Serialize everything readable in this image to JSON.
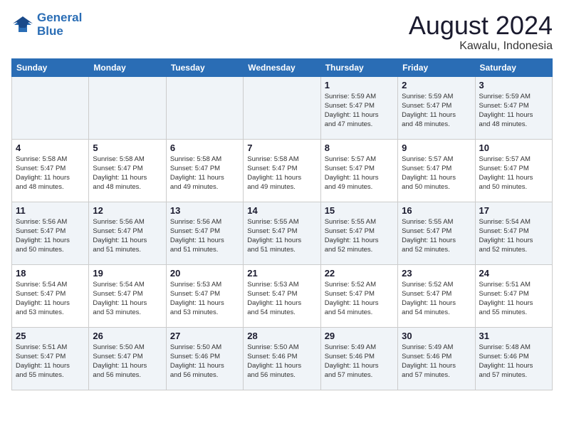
{
  "header": {
    "logo_line1": "General",
    "logo_line2": "Blue",
    "month_year": "August 2024",
    "location": "Kawalu, Indonesia"
  },
  "days_of_week": [
    "Sunday",
    "Monday",
    "Tuesday",
    "Wednesday",
    "Thursday",
    "Friday",
    "Saturday"
  ],
  "weeks": [
    [
      {
        "day": "",
        "info": ""
      },
      {
        "day": "",
        "info": ""
      },
      {
        "day": "",
        "info": ""
      },
      {
        "day": "",
        "info": ""
      },
      {
        "day": "1",
        "info": "Sunrise: 5:59 AM\nSunset: 5:47 PM\nDaylight: 11 hours\nand 47 minutes."
      },
      {
        "day": "2",
        "info": "Sunrise: 5:59 AM\nSunset: 5:47 PM\nDaylight: 11 hours\nand 48 minutes."
      },
      {
        "day": "3",
        "info": "Sunrise: 5:59 AM\nSunset: 5:47 PM\nDaylight: 11 hours\nand 48 minutes."
      }
    ],
    [
      {
        "day": "4",
        "info": "Sunrise: 5:58 AM\nSunset: 5:47 PM\nDaylight: 11 hours\nand 48 minutes."
      },
      {
        "day": "5",
        "info": "Sunrise: 5:58 AM\nSunset: 5:47 PM\nDaylight: 11 hours\nand 48 minutes."
      },
      {
        "day": "6",
        "info": "Sunrise: 5:58 AM\nSunset: 5:47 PM\nDaylight: 11 hours\nand 49 minutes."
      },
      {
        "day": "7",
        "info": "Sunrise: 5:58 AM\nSunset: 5:47 PM\nDaylight: 11 hours\nand 49 minutes."
      },
      {
        "day": "8",
        "info": "Sunrise: 5:57 AM\nSunset: 5:47 PM\nDaylight: 11 hours\nand 49 minutes."
      },
      {
        "day": "9",
        "info": "Sunrise: 5:57 AM\nSunset: 5:47 PM\nDaylight: 11 hours\nand 50 minutes."
      },
      {
        "day": "10",
        "info": "Sunrise: 5:57 AM\nSunset: 5:47 PM\nDaylight: 11 hours\nand 50 minutes."
      }
    ],
    [
      {
        "day": "11",
        "info": "Sunrise: 5:56 AM\nSunset: 5:47 PM\nDaylight: 11 hours\nand 50 minutes."
      },
      {
        "day": "12",
        "info": "Sunrise: 5:56 AM\nSunset: 5:47 PM\nDaylight: 11 hours\nand 51 minutes."
      },
      {
        "day": "13",
        "info": "Sunrise: 5:56 AM\nSunset: 5:47 PM\nDaylight: 11 hours\nand 51 minutes."
      },
      {
        "day": "14",
        "info": "Sunrise: 5:55 AM\nSunset: 5:47 PM\nDaylight: 11 hours\nand 51 minutes."
      },
      {
        "day": "15",
        "info": "Sunrise: 5:55 AM\nSunset: 5:47 PM\nDaylight: 11 hours\nand 52 minutes."
      },
      {
        "day": "16",
        "info": "Sunrise: 5:55 AM\nSunset: 5:47 PM\nDaylight: 11 hours\nand 52 minutes."
      },
      {
        "day": "17",
        "info": "Sunrise: 5:54 AM\nSunset: 5:47 PM\nDaylight: 11 hours\nand 52 minutes."
      }
    ],
    [
      {
        "day": "18",
        "info": "Sunrise: 5:54 AM\nSunset: 5:47 PM\nDaylight: 11 hours\nand 53 minutes."
      },
      {
        "day": "19",
        "info": "Sunrise: 5:54 AM\nSunset: 5:47 PM\nDaylight: 11 hours\nand 53 minutes."
      },
      {
        "day": "20",
        "info": "Sunrise: 5:53 AM\nSunset: 5:47 PM\nDaylight: 11 hours\nand 53 minutes."
      },
      {
        "day": "21",
        "info": "Sunrise: 5:53 AM\nSunset: 5:47 PM\nDaylight: 11 hours\nand 54 minutes."
      },
      {
        "day": "22",
        "info": "Sunrise: 5:52 AM\nSunset: 5:47 PM\nDaylight: 11 hours\nand 54 minutes."
      },
      {
        "day": "23",
        "info": "Sunrise: 5:52 AM\nSunset: 5:47 PM\nDaylight: 11 hours\nand 54 minutes."
      },
      {
        "day": "24",
        "info": "Sunrise: 5:51 AM\nSunset: 5:47 PM\nDaylight: 11 hours\nand 55 minutes."
      }
    ],
    [
      {
        "day": "25",
        "info": "Sunrise: 5:51 AM\nSunset: 5:47 PM\nDaylight: 11 hours\nand 55 minutes."
      },
      {
        "day": "26",
        "info": "Sunrise: 5:50 AM\nSunset: 5:47 PM\nDaylight: 11 hours\nand 56 minutes."
      },
      {
        "day": "27",
        "info": "Sunrise: 5:50 AM\nSunset: 5:46 PM\nDaylight: 11 hours\nand 56 minutes."
      },
      {
        "day": "28",
        "info": "Sunrise: 5:50 AM\nSunset: 5:46 PM\nDaylight: 11 hours\nand 56 minutes."
      },
      {
        "day": "29",
        "info": "Sunrise: 5:49 AM\nSunset: 5:46 PM\nDaylight: 11 hours\nand 57 minutes."
      },
      {
        "day": "30",
        "info": "Sunrise: 5:49 AM\nSunset: 5:46 PM\nDaylight: 11 hours\nand 57 minutes."
      },
      {
        "day": "31",
        "info": "Sunrise: 5:48 AM\nSunset: 5:46 PM\nDaylight: 11 hours\nand 57 minutes."
      }
    ]
  ]
}
